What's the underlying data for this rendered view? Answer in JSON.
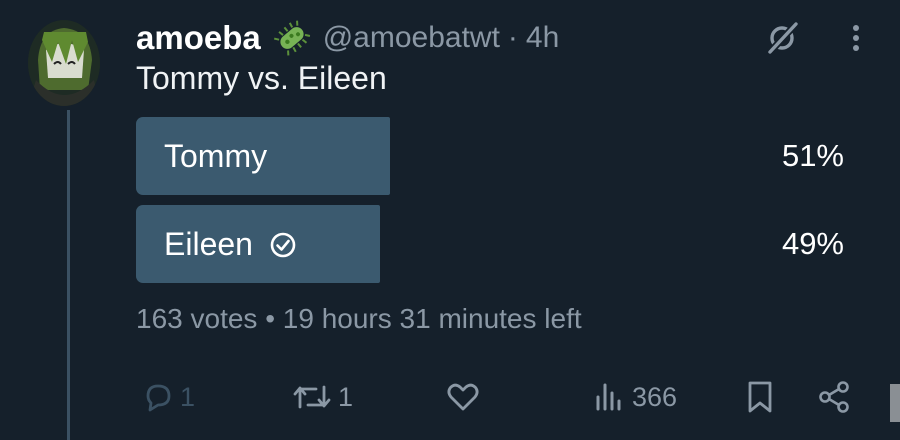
{
  "tweet": {
    "display_name": "amoeba",
    "badge_icon": "microbe-emoji-icon",
    "handle": "@amoebatwt",
    "separator": "·",
    "time": "4h",
    "text": "Tommy vs. Eileen"
  },
  "poll": {
    "options": [
      {
        "label": "Tommy",
        "percent": "51%",
        "value": 51,
        "voted": false
      },
      {
        "label": "Eileen",
        "percent": "49%",
        "value": 49,
        "voted": true
      }
    ],
    "meta": "163 votes • 19 hours 31 minutes left"
  },
  "actions": {
    "replies": "1",
    "reposts": "1",
    "likes": "",
    "views": "366"
  },
  "colors": {
    "background": "#15202b",
    "poll_fill": "#3b5a6f",
    "secondary_text": "#8b98a5"
  }
}
